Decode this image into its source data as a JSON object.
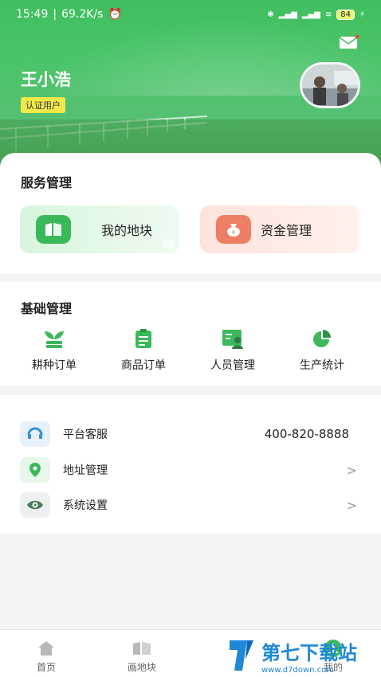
{
  "status": {
    "time": "15:49",
    "speed": "69.2K/s",
    "battery": "84"
  },
  "header": {
    "username": "王小浩",
    "badge": "认证用户"
  },
  "service": {
    "title": "服务管理",
    "items": [
      {
        "label": "我的地块"
      },
      {
        "label": "资金管理"
      }
    ]
  },
  "basic": {
    "title": "基础管理",
    "items": [
      {
        "label": "耕种订单"
      },
      {
        "label": "商品订单"
      },
      {
        "label": "人员管理"
      },
      {
        "label": "生产统计"
      }
    ]
  },
  "list": {
    "items": [
      {
        "label": "平台客服",
        "value": "400-820-8888"
      },
      {
        "label": "地址管理"
      },
      {
        "label": "系统设置"
      }
    ]
  },
  "tabs": [
    {
      "label": "首页"
    },
    {
      "label": "画地块"
    },
    {
      "label": "我的"
    }
  ],
  "watermark": {
    "title": "第七下载站",
    "url": "www.d7down.com"
  },
  "colors": {
    "primary": "#3bb85a",
    "accent": "#ef7f64"
  }
}
